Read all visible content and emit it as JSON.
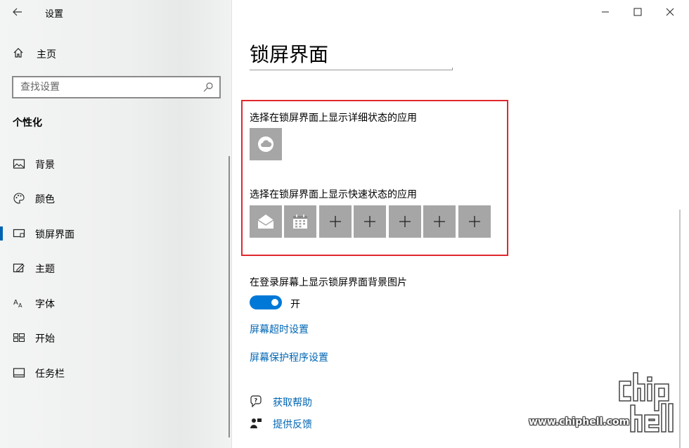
{
  "window": {
    "title": "设置",
    "minimize": "minimize",
    "maximize": "maximize",
    "close": "close"
  },
  "sidebar": {
    "home_label": "主页",
    "search_placeholder": "查找设置",
    "section_title": "个性化",
    "items": [
      {
        "label": "背景",
        "icon": "picture-icon"
      },
      {
        "label": "颜色",
        "icon": "palette-icon"
      },
      {
        "label": "锁屏界面",
        "icon": "lockscreen-icon",
        "active": true
      },
      {
        "label": "主题",
        "icon": "theme-icon"
      },
      {
        "label": "字体",
        "icon": "font-icon"
      },
      {
        "label": "开始",
        "icon": "start-icon"
      },
      {
        "label": "任务栏",
        "icon": "taskbar-icon"
      }
    ]
  },
  "main": {
    "page_title": "锁屏界面",
    "detailed_status_label": "选择在锁屏界面上显示详细状态的应用",
    "detailed_status_app": "weather-icon",
    "quick_status_label": "选择在锁屏界面上显示快速状态的应用",
    "quick_status_apps": [
      "mail-icon",
      "calendar-icon",
      "plus-icon",
      "plus-icon",
      "plus-icon",
      "plus-icon",
      "plus-icon"
    ],
    "signin_bg_label": "在登录屏幕上显示锁屏界面背景图片",
    "signin_bg_toggle_state": "开",
    "signin_bg_toggle_on": true,
    "screen_timeout_link": "屏幕超时设置",
    "screensaver_link": "屏幕保护程序设置",
    "help_link": "获取帮助",
    "feedback_link": "提供反馈"
  },
  "watermark": {
    "logo": "chip hell",
    "url": "www.chiphell.com"
  },
  "colors": {
    "accent": "#0078d7",
    "link": "#0066b4",
    "highlight_border": "#e0282e",
    "tile": "#a6a6a6"
  }
}
